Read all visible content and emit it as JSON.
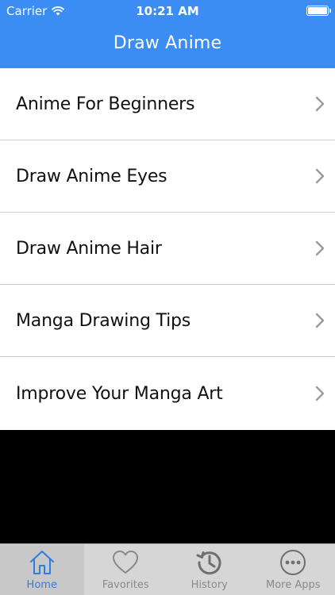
{
  "status_bar": {
    "carrier": "Carrier",
    "time": "10:21 AM"
  },
  "nav": {
    "title": "Draw Anime"
  },
  "list": {
    "items": [
      {
        "label": "Anime For Beginners"
      },
      {
        "label": "Draw Anime Eyes"
      },
      {
        "label": "Draw Anime Hair"
      },
      {
        "label": "Manga Drawing Tips"
      },
      {
        "label": "Improve Your Manga Art"
      }
    ]
  },
  "tabs": [
    {
      "label": "Home",
      "icon": "home-icon",
      "active": true
    },
    {
      "label": "Favorites",
      "icon": "heart-icon",
      "active": false
    },
    {
      "label": "History",
      "icon": "history-icon",
      "active": false
    },
    {
      "label": "More Apps",
      "icon": "more-icon",
      "active": false
    }
  ],
  "colors": {
    "accent": "#3b8cf3",
    "tab_active": "#2f7de1",
    "tab_inactive": "#8a8a8a"
  }
}
